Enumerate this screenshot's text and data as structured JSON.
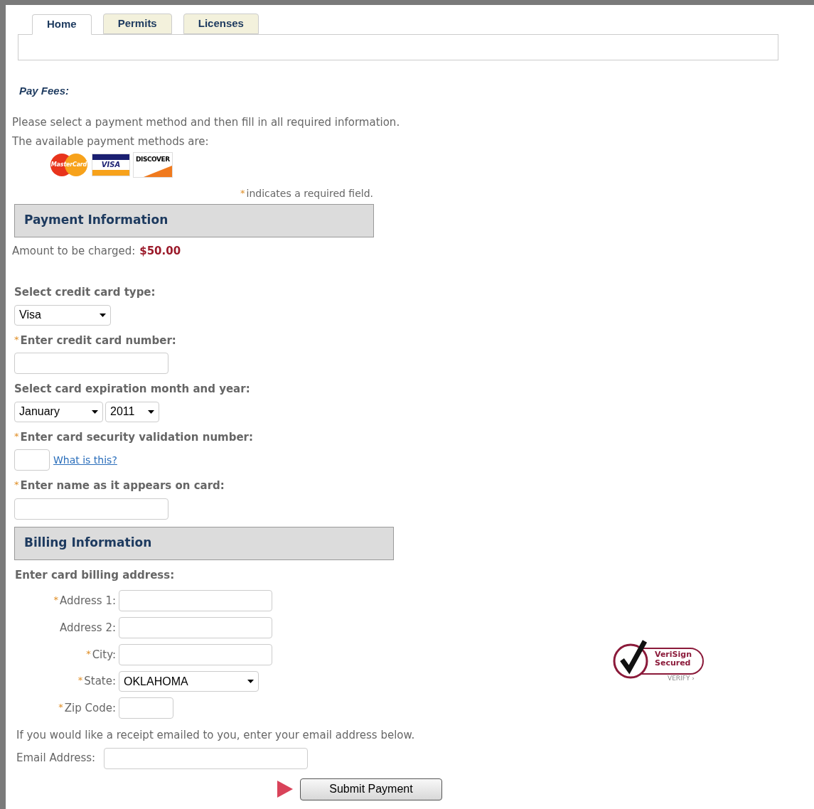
{
  "tabs": [
    {
      "label": "Home",
      "selected": true
    },
    {
      "label": "Permits",
      "selected": false
    },
    {
      "label": "Licenses",
      "selected": false
    }
  ],
  "heading": "Pay Fees:",
  "intro": [
    "Please select a payment method and then fill in all required information.",
    "The available payment methods are:"
  ],
  "card_logos": [
    {
      "kind": "mastercard",
      "label": "MasterCard"
    },
    {
      "kind": "visa",
      "label": "VISA"
    },
    {
      "kind": "discover",
      "label": "DISCOVER"
    }
  ],
  "required_mark": "*",
  "required_note": "indicates a required field.",
  "payment_section": {
    "title": "Payment Information",
    "amount_label": "Amount to be charged:",
    "amount": "$50.00",
    "fields": [
      {
        "kind": "select",
        "label": "Select credit card type:",
        "required": false,
        "values": [
          "Visa"
        ]
      },
      {
        "kind": "text",
        "label": "Enter credit card number:",
        "required": true
      },
      {
        "kind": "select",
        "label": "Select card expiration month and year:",
        "required": false,
        "values": [
          "January",
          "2011"
        ]
      },
      {
        "kind": "cvv",
        "label": "Enter card security validation number:",
        "required": true,
        "link": "What is this?"
      },
      {
        "kind": "text",
        "label": "Enter name as it appears on card:",
        "required": true
      }
    ]
  },
  "billing_section": {
    "title": "Billing Information",
    "subtitle": "Enter card billing address:",
    "fields": [
      {
        "kind": "text",
        "label": "Address 1:",
        "required": true
      },
      {
        "kind": "text",
        "label": "Address 2:",
        "required": false
      },
      {
        "kind": "text",
        "label": "City:",
        "required": true
      },
      {
        "kind": "select",
        "label": "State:",
        "required": true,
        "value": "OKLAHOMA"
      },
      {
        "kind": "short",
        "label": "Zip Code:",
        "required": true
      }
    ]
  },
  "email_note": "If you would like a receipt emailed to you, enter your email address below.",
  "email_label": "Email Address:",
  "seal": {
    "name": "VeriSign",
    "line2": "Secured",
    "verify": "VERIFY ›"
  },
  "submit": "Submit Payment"
}
